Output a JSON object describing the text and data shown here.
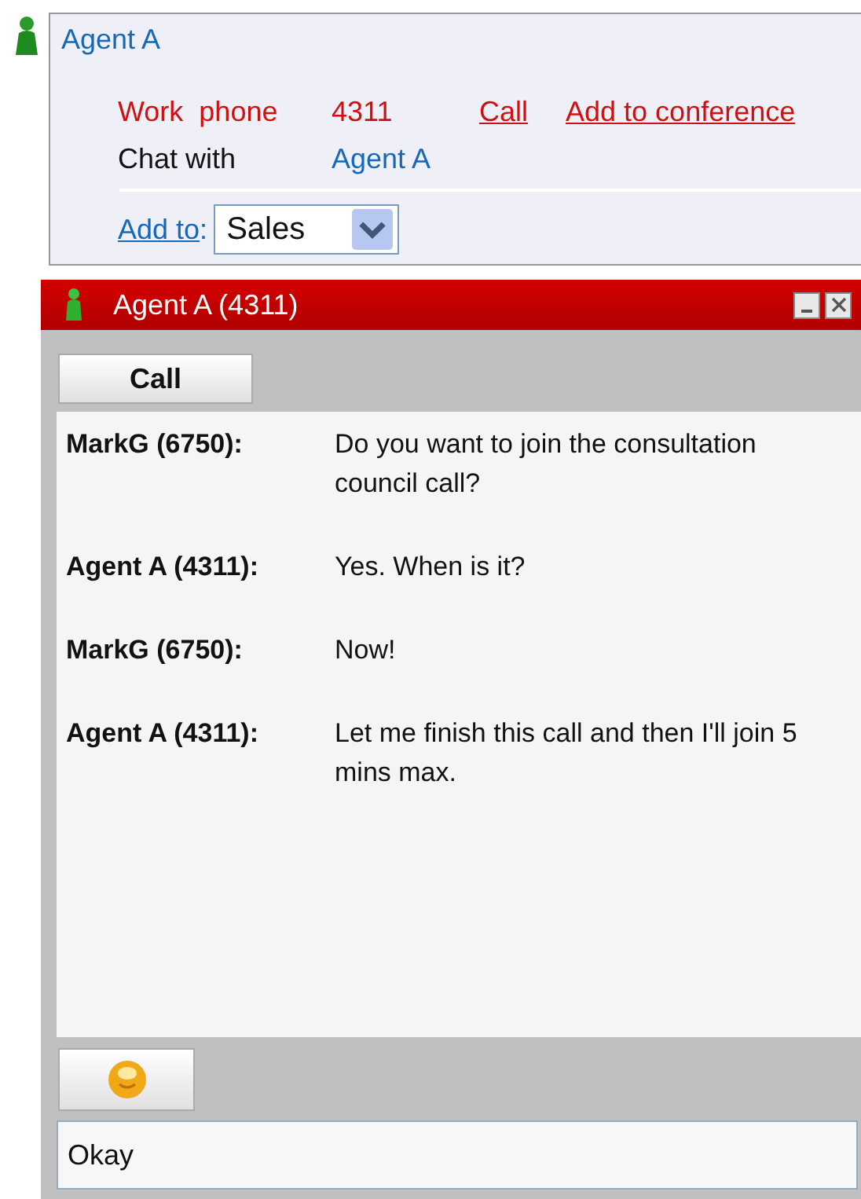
{
  "contact": {
    "name": "Agent A",
    "rows": [
      {
        "kind": "phone",
        "label": "Work  phone",
        "value": "4311",
        "actions": [
          "Call",
          "Add to conference"
        ]
      },
      {
        "kind": "chat",
        "label": "Chat with",
        "value": "Agent A",
        "actions": []
      }
    ],
    "add_to": {
      "label": "Add to",
      "colon": ":",
      "value": "Sales"
    }
  },
  "chat_window": {
    "title": "Agent A (4311)",
    "call_button": "Call",
    "messages": [
      {
        "sender": "MarkG (6750):",
        "text": "Do you want to join the consultation council call?"
      },
      {
        "sender": "Agent A (4311):",
        "text": "Yes. When is it?"
      },
      {
        "sender": "MarkG (6750):",
        "text": "Now!"
      },
      {
        "sender": "Agent A (4311):",
        "text": "Let me finish this call and then I'll join 5 mins max."
      }
    ],
    "input": {
      "value": "Okay"
    }
  }
}
